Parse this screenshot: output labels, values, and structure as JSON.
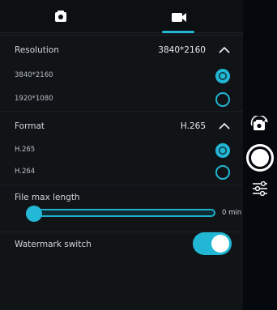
{
  "tabs": [
    {
      "icon": "camera-icon",
      "label": ""
    },
    {
      "icon": "video-camera-icon",
      "label": ""
    }
  ],
  "resolution": {
    "label": "Resolution",
    "value": "3840*2160",
    "options": [
      {
        "label": "3840*2160",
        "selected": true
      },
      {
        "label": "1920*1080",
        "selected": false
      }
    ]
  },
  "format": {
    "label": "Format",
    "value": "H.265",
    "options": [
      {
        "label": "H.265",
        "selected": true
      },
      {
        "label": "H.264",
        "selected": false
      }
    ]
  },
  "file_max_length": {
    "label": "File max length",
    "value": "0 min",
    "level": 0
  },
  "watermark": {
    "label": "Watermark switch",
    "enabled": true
  },
  "colors": {
    "accent": "#21b6d4",
    "panel": "#111417",
    "background": "#05080c"
  },
  "side_controls": {
    "switch_camera_icon": "switch-camera-icon",
    "shutter_icon": "shutter-button",
    "settings_icon": "sliders-icon"
  }
}
